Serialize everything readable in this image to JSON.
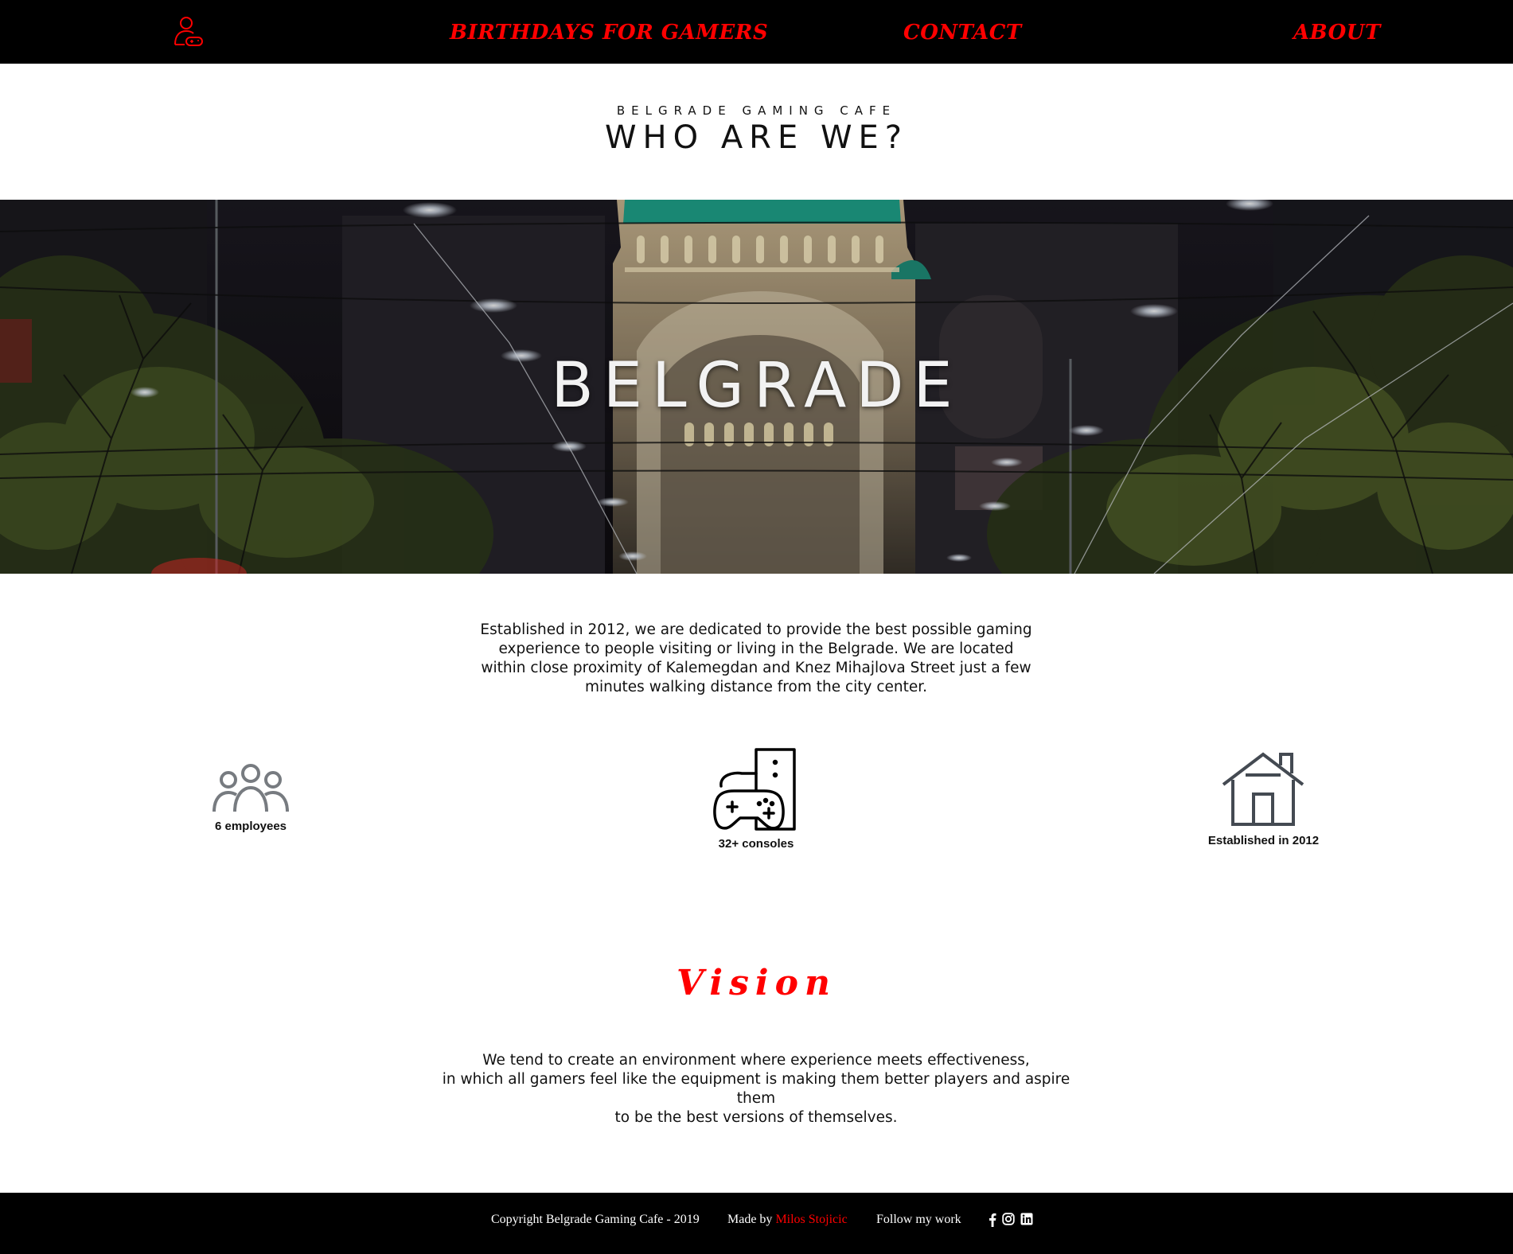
{
  "nav": {
    "logo_icon": "gamer-person-icon",
    "links": [
      {
        "label": "BIRTHDAYS FOR GAMERS"
      },
      {
        "label": "CONTACT"
      },
      {
        "label": "ABOUT"
      }
    ],
    "accent_color": "#ff0000"
  },
  "header": {
    "eyebrow": "BELGRADE GAMING CAFE",
    "title": "WHO ARE WE?"
  },
  "hero": {
    "title": "BELGRADE"
  },
  "intro": {
    "text": "Established in 2012, we are dedicated to provide the best possible gaming experience to people visiting or living in the Belgrade. We are located within close proximity of Kalemegdan and Knez Mihajlova Street just a few minutes walking distance from the city center."
  },
  "stats": [
    {
      "icon": "people-group-icon",
      "label": "6 employees"
    },
    {
      "icon": "console-gamepad-icon",
      "label": "32+ consoles"
    },
    {
      "icon": "house-icon",
      "label": "Established in 2012"
    }
  ],
  "vision": {
    "title": "Vision",
    "line1": "We tend to create an environment where experience meets effectiveness,",
    "line2": "in which all gamers feel like the equipment is making them better players and aspire them",
    "line3": "to be the best versions of themselves."
  },
  "footer": {
    "copyright": "Copyright Belgrade Gaming Cafe - 2019",
    "made_by_prefix": "Made by ",
    "author": "Milos Stojicic",
    "follow": "Follow my work",
    "social_icons": [
      "facebook-icon",
      "instagram-icon",
      "linkedin-icon"
    ]
  }
}
